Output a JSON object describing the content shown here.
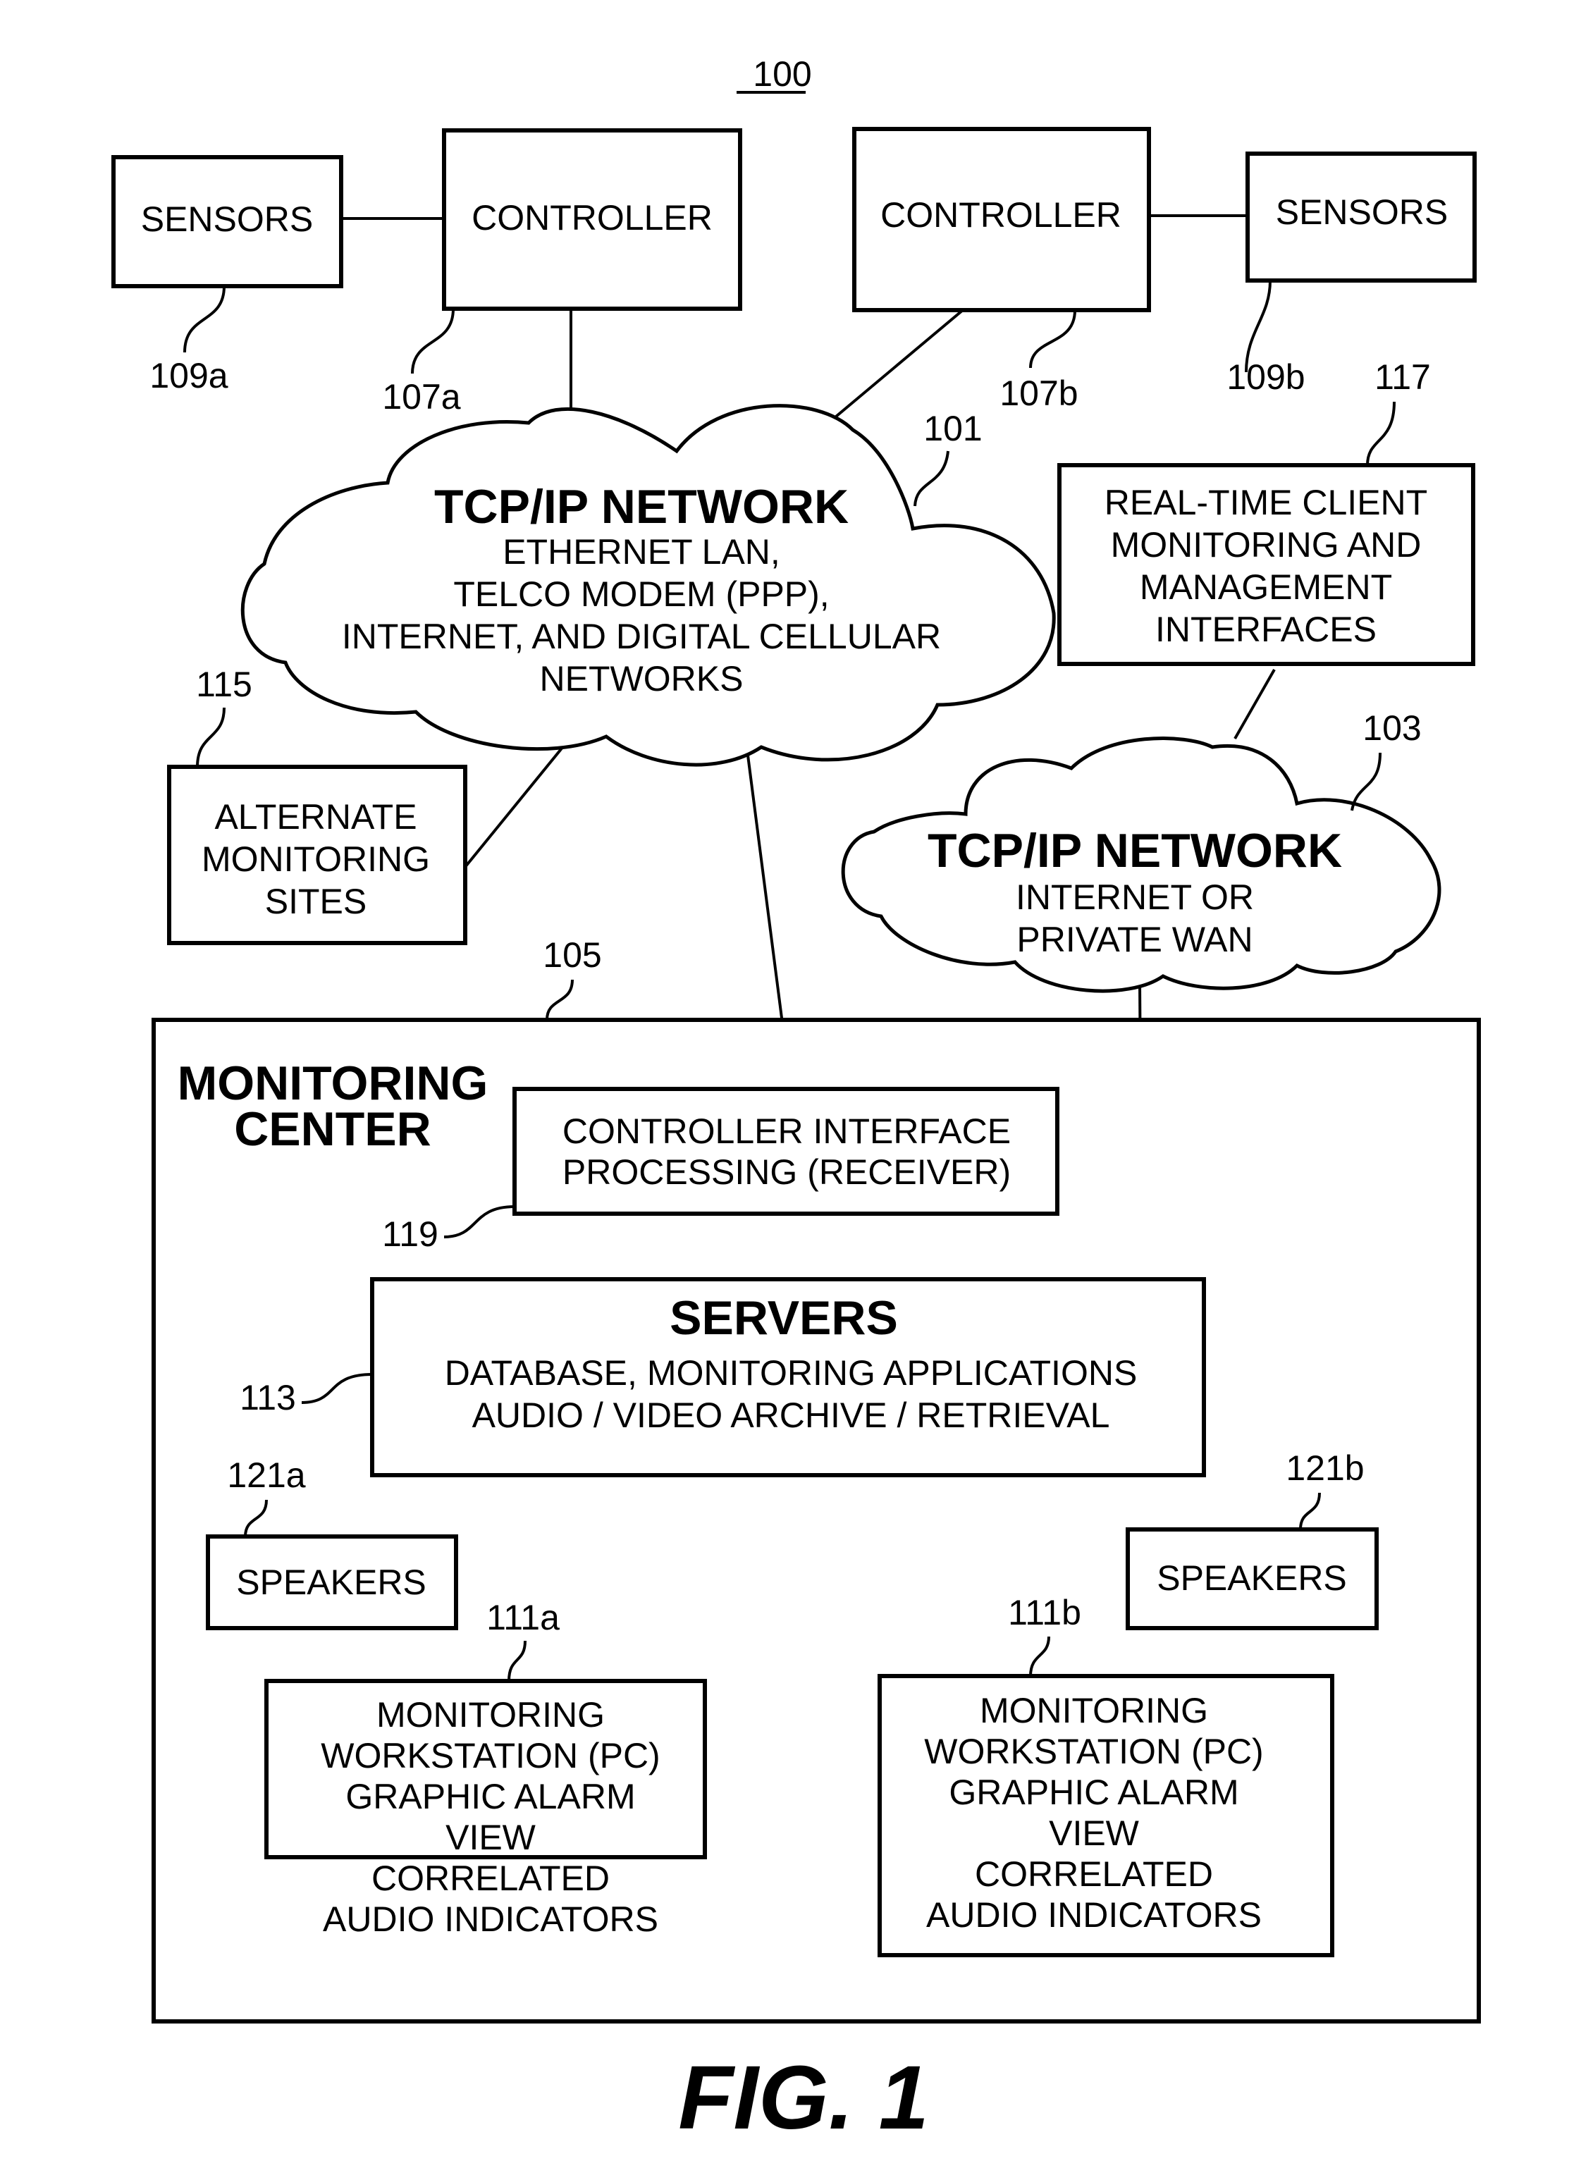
{
  "figure": {
    "system_ref": "100",
    "caption": "FIG. 1"
  },
  "nodes": {
    "sensors_a": {
      "ref": "109a",
      "lines": [
        "SENSORS"
      ]
    },
    "controller_a": {
      "ref": "107a",
      "lines": [
        "CONTROLLER"
      ]
    },
    "controller_b": {
      "ref": "107b",
      "lines": [
        "CONTROLLER"
      ]
    },
    "sensors_b": {
      "ref": "109b",
      "lines": [
        "SENSORS"
      ]
    },
    "network_101": {
      "ref": "101",
      "title": "TCP/IP NETWORK",
      "lines": [
        "ETHERNET LAN,",
        "TELCO MODEM (PPP),",
        "INTERNET, AND DIGITAL CELLULAR",
        "NETWORKS"
      ]
    },
    "realtime_client": {
      "ref": "117",
      "lines": [
        "REAL-TIME CLIENT",
        "MONITORING AND",
        "MANAGEMENT",
        "INTERFACES"
      ]
    },
    "alternate_sites": {
      "ref": "115",
      "lines": [
        "ALTERNATE",
        "MONITORING",
        "SITES"
      ]
    },
    "network_103": {
      "ref": "103",
      "title": "TCP/IP NETWORK",
      "lines": [
        "INTERNET OR",
        "PRIVATE WAN"
      ]
    },
    "monitoring_center": {
      "ref": "105",
      "title_lines": [
        "MONITORING",
        "CENTER"
      ]
    },
    "controller_interface": {
      "ref": "119",
      "lines": [
        "CONTROLLER INTERFACE",
        "PROCESSING (RECEIVER)"
      ]
    },
    "servers": {
      "ref": "113",
      "title": "SERVERS",
      "lines": [
        "DATABASE, MONITORING APPLICATIONS",
        "AUDIO / VIDEO ARCHIVE / RETRIEVAL"
      ]
    },
    "speakers_a": {
      "ref": "121a",
      "lines": [
        "SPEAKERS"
      ]
    },
    "speakers_b": {
      "ref": "121b",
      "lines": [
        "SPEAKERS"
      ]
    },
    "workstation_a": {
      "ref": "111a",
      "lines": [
        "MONITORING",
        "WORKSTATION (PC)",
        "GRAPHIC ALARM",
        "VIEW",
        "CORRELATED",
        "AUDIO INDICATORS"
      ]
    },
    "workstation_b": {
      "ref": "111b",
      "lines": [
        "MONITORING",
        "WORKSTATION (PC)",
        "GRAPHIC ALARM",
        "VIEW",
        "CORRELATED",
        "AUDIO INDICATORS"
      ]
    }
  },
  "connections": [
    {
      "from": "sensors_a",
      "to": "controller_a"
    },
    {
      "from": "controller_b",
      "to": "sensors_b"
    },
    {
      "from": "controller_a",
      "to": "network_101"
    },
    {
      "from": "controller_b",
      "to": "network_101"
    },
    {
      "from": "network_101",
      "to": "alternate_sites"
    },
    {
      "from": "network_101",
      "to": "controller_interface"
    },
    {
      "from": "realtime_client",
      "to": "network_103"
    },
    {
      "from": "network_103",
      "to": "servers"
    },
    {
      "from": "controller_interface",
      "to": "servers"
    },
    {
      "from": "servers",
      "to": "workstation_a"
    },
    {
      "from": "servers",
      "to": "workstation_b"
    },
    {
      "from": "speakers_a",
      "to": "workstation_a"
    },
    {
      "from": "speakers_b",
      "to": "workstation_b"
    }
  ]
}
